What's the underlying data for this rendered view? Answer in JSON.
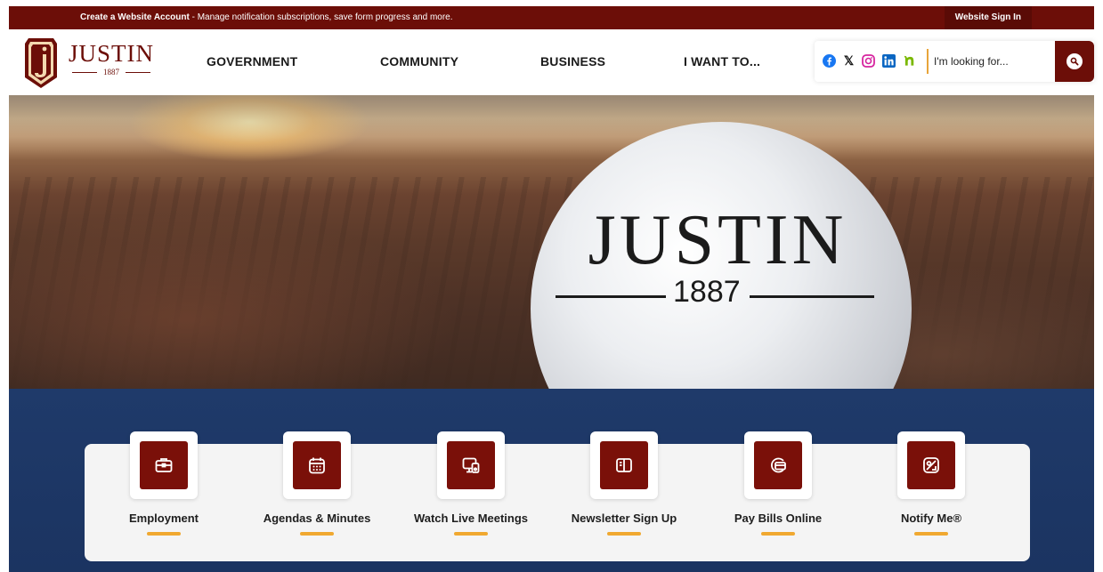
{
  "topbar": {
    "create_account": "Create a Website Account",
    "message": " - Manage notification subscriptions, save form progress and more.",
    "sign_in": "Website Sign In"
  },
  "logo": {
    "name": "JUSTIN",
    "year": "1887"
  },
  "nav": [
    {
      "label": "GOVERNMENT"
    },
    {
      "label": "COMMUNITY"
    },
    {
      "label": "BUSINESS"
    },
    {
      "label": "I WANT TO..."
    }
  ],
  "social": [
    {
      "icon": "facebook-icon",
      "glyph": "f",
      "color": "#1877f2"
    },
    {
      "icon": "x-twitter-icon",
      "glyph": "𝕏",
      "color": "#111111"
    },
    {
      "icon": "instagram-icon",
      "glyph": "◎",
      "color": "#d6249f"
    },
    {
      "icon": "linkedin-icon",
      "glyph": "in",
      "color": "#0a66c2"
    },
    {
      "icon": "nextdoor-icon",
      "glyph": "n",
      "color": "#7ab800"
    }
  ],
  "search": {
    "placeholder": "I'm looking for...",
    "icon": "search-icon"
  },
  "hero": {
    "tower_name": "JUSTIN",
    "tower_year": "1887"
  },
  "quick_links": [
    {
      "label": "Employment",
      "icon": "briefcase-icon"
    },
    {
      "label": "Agendas & Minutes",
      "icon": "calendar-icon"
    },
    {
      "label": "Watch Live Meetings",
      "icon": "monitor-icon"
    },
    {
      "label": "Newsletter Sign Up",
      "icon": "open-book-icon"
    },
    {
      "label": "Pay Bills Online",
      "icon": "card-payment-icon"
    },
    {
      "label": "Notify Me®",
      "icon": "notify-icon"
    }
  ],
  "colors": {
    "brand": "#6c0e08",
    "accent": "#f0a830",
    "navy": "#1f3a6a"
  }
}
